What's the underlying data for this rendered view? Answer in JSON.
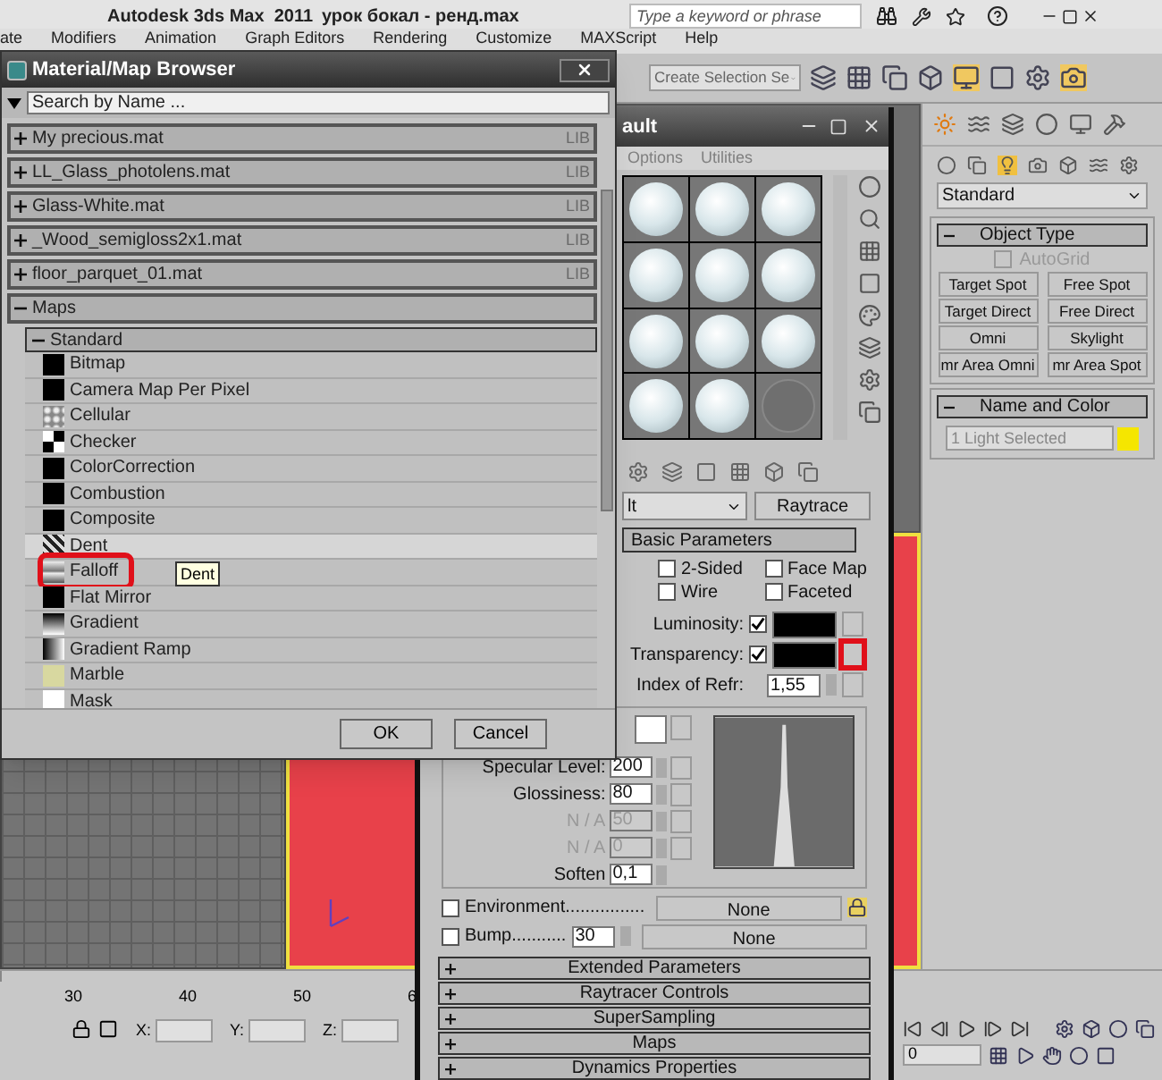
{
  "app": {
    "title": "Autodesk 3ds Max  2011",
    "file": "урок бокал - ренд.max",
    "search_placeholder": "Type a keyword or phrase"
  },
  "menu": [
    "ate",
    "Modifiers",
    "Animation",
    "Graph Editors",
    "Rendering",
    "Customize",
    "MAXScript",
    "Help"
  ],
  "toolbar": {
    "selection_set": "Create Selection Se"
  },
  "browser": {
    "title": "Material/Map Browser",
    "search_placeholder": "Search by Name ...",
    "libraries": [
      {
        "name": "My precious.mat",
        "tag": "LIB",
        "expanded": false
      },
      {
        "name": "LL_Glass_photolens.mat",
        "tag": "LIB",
        "expanded": false
      },
      {
        "name": "Glass-White.mat",
        "tag": "LIB",
        "expanded": false
      },
      {
        "name": "_Wood_semigloss2x1.mat",
        "tag": "LIB",
        "expanded": false
      },
      {
        "name": "floor_parquet_01.mat",
        "tag": "LIB",
        "expanded": false
      }
    ],
    "maps_group": {
      "name": "Maps",
      "expanded": true
    },
    "standard_group": {
      "name": "Standard",
      "expanded": true
    },
    "items": [
      {
        "name": "Bitmap",
        "kind": "black",
        "hovered": false,
        "marked": false
      },
      {
        "name": "Camera Map Per Pixel",
        "kind": "black",
        "hovered": false,
        "marked": false
      },
      {
        "name": "Cellular",
        "kind": "cells",
        "hovered": false,
        "marked": false
      },
      {
        "name": "Checker",
        "kind": "checker",
        "hovered": false,
        "marked": false
      },
      {
        "name": "ColorCorrection",
        "kind": "black",
        "hovered": false,
        "marked": false
      },
      {
        "name": "Combustion",
        "kind": "black",
        "hovered": false,
        "marked": false
      },
      {
        "name": "Composite",
        "kind": "black",
        "hovered": false,
        "marked": false
      },
      {
        "name": "Dent",
        "kind": "noise",
        "hovered": true,
        "marked": false
      },
      {
        "name": "Falloff",
        "kind": "falloff",
        "hovered": false,
        "marked": true
      },
      {
        "name": "Flat Mirror",
        "kind": "black",
        "hovered": false,
        "marked": false
      },
      {
        "name": "Gradient",
        "kind": "gradient",
        "hovered": false,
        "marked": false
      },
      {
        "name": "Gradient Ramp",
        "kind": "ramp",
        "hovered": false,
        "marked": false
      },
      {
        "name": "Marble",
        "kind": "marble",
        "hovered": false,
        "marked": false
      },
      {
        "name": "Mask",
        "kind": "white",
        "hovered": false,
        "marked": false
      }
    ],
    "tooltip": "Dent",
    "buttons": [
      "OK",
      "Cancel"
    ]
  },
  "material_editor": {
    "title": "ault",
    "menu": [
      "Options",
      "Utilities"
    ],
    "samples": [
      {
        "kind": "sphere"
      },
      {
        "kind": "sphere"
      },
      {
        "kind": "sphere"
      },
      {
        "kind": "sphere"
      },
      {
        "kind": "sphere"
      },
      {
        "kind": "sphere"
      },
      {
        "kind": "sphere"
      },
      {
        "kind": "sphere"
      },
      {
        "kind": "sphere"
      },
      {
        "kind": "sphere"
      },
      {
        "kind": "sphere"
      },
      {
        "kind": "empty"
      }
    ],
    "type_value": "lt",
    "type_button": "Raytrace",
    "basic": {
      "title": "Basic Parameters",
      "checks": [
        {
          "label": "2-Sided",
          "checked": false
        },
        {
          "label": "Face Map",
          "checked": false
        },
        {
          "label": "Wire",
          "checked": false
        },
        {
          "label": "Faceted",
          "checked": false
        }
      ],
      "colors": [
        {
          "label": "Luminosity:",
          "checked": true,
          "marked": false
        },
        {
          "label": "Transparency:",
          "checked": true,
          "marked": true
        }
      ],
      "ior": {
        "label": "Index of Refr:",
        "value": "1,55"
      },
      "spinners": [
        {
          "label": "Specular Level:",
          "value": "200",
          "disabled": false
        },
        {
          "label": "Glossiness:",
          "value": "80",
          "disabled": false
        },
        {
          "label": "N / A",
          "value": "50",
          "disabled": true
        },
        {
          "label": "N / A",
          "value": "0",
          "disabled": true
        }
      ],
      "soften": {
        "label": "Soften",
        "value": "0,1"
      },
      "maps": [
        {
          "label": "Environment................",
          "checked": false,
          "button": "None"
        },
        {
          "label": "Bump...........",
          "checked": false,
          "amount": "30",
          "button": "None"
        }
      ]
    },
    "rollouts": [
      "Extended Parameters",
      "Raytracer Controls",
      "SuperSampling",
      "Maps",
      "Dynamics Properties"
    ]
  },
  "command_panel": {
    "category": "Standard",
    "object_type": {
      "title": "Object Type",
      "autogrid": {
        "label": "AutoGrid",
        "checked": false
      },
      "buttons": [
        "Target Spot",
        "Free Spot",
        "Target Direct",
        "Free Direct",
        "Omni",
        "Skylight",
        "mr Area Omni",
        "mr Area Spot"
      ]
    },
    "name_color": {
      "title": "Name and Color",
      "name": "1 Light Selected",
      "color": "#f5e600"
    }
  },
  "timeline": {
    "ticks": [
      "30",
      "40",
      "50",
      "6"
    ]
  },
  "status": {
    "coords": [
      "X:",
      "Y:",
      "Z:"
    ],
    "frame": "0"
  }
}
